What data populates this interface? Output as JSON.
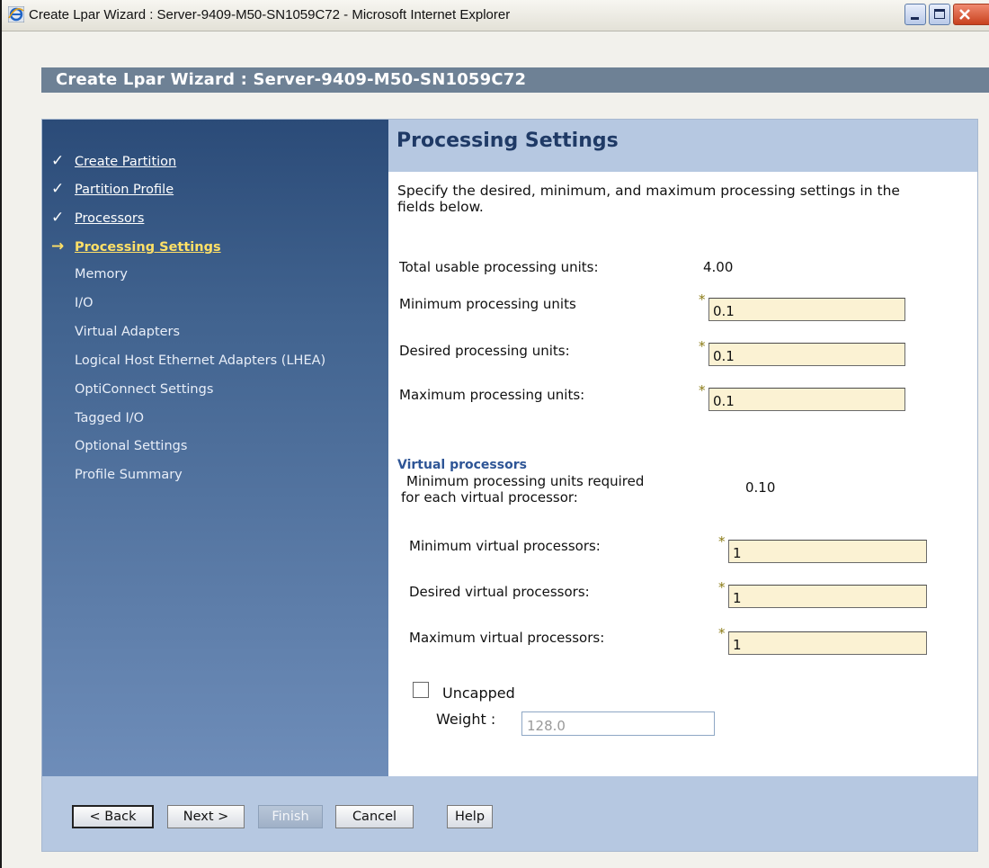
{
  "window": {
    "title": "Create Lpar Wizard : Server-9409-M50-SN1059C72 - Microsoft Internet Explorer",
    "icon": "ie-icon",
    "controls": [
      "minimize-icon",
      "maximize-icon",
      "close-icon"
    ]
  },
  "wizard": {
    "title": "Create Lpar Wizard : Server-9409-M50-SN1059C72"
  },
  "nav": {
    "items": [
      {
        "label": "Create Partition",
        "state": "done",
        "marker": "✓"
      },
      {
        "label": "Partition Profile",
        "state": "done",
        "marker": "✓"
      },
      {
        "label": "Processors",
        "state": "done",
        "marker": "✓"
      },
      {
        "label": "Processing Settings",
        "state": "current",
        "marker": "→"
      },
      {
        "label": "Memory",
        "state": "pending"
      },
      {
        "label": "I/O",
        "state": "pending"
      },
      {
        "label": "Virtual Adapters",
        "state": "pending"
      },
      {
        "label": "Logical Host Ethernet Adapters (LHEA)",
        "state": "pending"
      },
      {
        "label": "OptiConnect Settings",
        "state": "pending"
      },
      {
        "label": "Tagged I/O",
        "state": "pending"
      },
      {
        "label": "Optional Settings",
        "state": "pending"
      },
      {
        "label": "Profile Summary",
        "state": "pending"
      }
    ]
  },
  "content": {
    "title": "Processing Settings",
    "intro": "Specify the desired, minimum, and maximum processing settings in the fields below.",
    "total_label": "Total usable processing units:",
    "total_value": "4.00",
    "min_units_label": "Minimum processing units",
    "min_units_value": "0.1",
    "desired_units_label": "Desired processing units:",
    "desired_units_value": "0.1",
    "max_units_label": "Maximum processing units:",
    "max_units_value": "0.1",
    "required_marker": "*",
    "virtual": {
      "heading": "Virtual processors",
      "per_vp_label_line1": "Minimum processing units required",
      "per_vp_label_line2": "for each virtual processor:",
      "per_vp_value": "0.10",
      "min_label": "Minimum virtual processors:",
      "min_value": "1",
      "desired_label": "Desired virtual processors:",
      "desired_value": "1",
      "max_label": "Maximum virtual processors:",
      "max_value": "1"
    },
    "uncapped_label": "Uncapped",
    "uncapped_checked": false,
    "weight_label": "Weight :",
    "weight_value": "128.0"
  },
  "buttons": {
    "back": "< Back",
    "next": "Next >",
    "finish": "Finish",
    "cancel": "Cancel",
    "help": "Help"
  },
  "colors": {
    "header_bar": "#6e8195",
    "nav_top": "#2b4b78",
    "nav_bottom": "#6e8db9",
    "content_head": "#b6c8e1",
    "current_step": "#ffe066",
    "field_bg": "#fbf2d3"
  }
}
